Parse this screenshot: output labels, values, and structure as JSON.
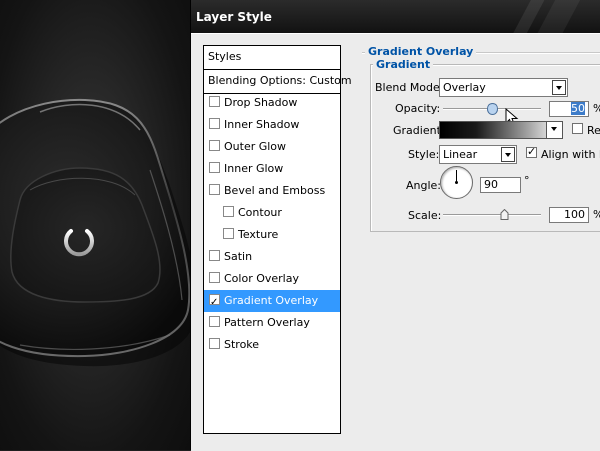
{
  "dialog": {
    "title": "Layer Style"
  },
  "styles_list": {
    "header": "Styles",
    "blending_options": "Blending Options: Custom",
    "items": [
      {
        "label": "Drop Shadow",
        "checked": false,
        "sub": false,
        "selected": false
      },
      {
        "label": "Inner Shadow",
        "checked": false,
        "sub": false,
        "selected": false
      },
      {
        "label": "Outer Glow",
        "checked": false,
        "sub": false,
        "selected": false
      },
      {
        "label": "Inner Glow",
        "checked": false,
        "sub": false,
        "selected": false
      },
      {
        "label": "Bevel and Emboss",
        "checked": false,
        "sub": false,
        "selected": false
      },
      {
        "label": "Contour",
        "checked": false,
        "sub": true,
        "selected": false
      },
      {
        "label": "Texture",
        "checked": false,
        "sub": true,
        "selected": false
      },
      {
        "label": "Satin",
        "checked": false,
        "sub": false,
        "selected": false
      },
      {
        "label": "Color Overlay",
        "checked": false,
        "sub": false,
        "selected": false
      },
      {
        "label": "Gradient Overlay",
        "checked": true,
        "sub": false,
        "selected": true
      },
      {
        "label": "Pattern Overlay",
        "checked": false,
        "sub": false,
        "selected": false
      },
      {
        "label": "Stroke",
        "checked": false,
        "sub": false,
        "selected": false
      }
    ]
  },
  "gradient_overlay": {
    "section_title": "Gradient Overlay",
    "group_title": "Gradient",
    "blend_mode_label": "Blend Mode:",
    "blend_mode_value": "Overlay",
    "opacity_label": "Opacity:",
    "opacity_value": "50",
    "opacity_unit": "%",
    "opacity_level": 0.5,
    "gradient_label": "Gradient:",
    "reverse_label": "Rev",
    "reverse_checked": false,
    "style_label": "Style:",
    "style_value": "Linear",
    "align_label": "Align with La",
    "align_checked": true,
    "angle_label": "Angle:",
    "angle_value": "90",
    "angle_unit": "°",
    "scale_label": "Scale:",
    "scale_value": "100",
    "scale_unit": "%"
  },
  "colors": {
    "accent_blue": "#0053a6",
    "selection": "#3399ff",
    "dialog_bg": "#ececec",
    "titlebar": "#1a1a1a"
  },
  "icons": [
    "power-icon",
    "mouse-cursor-icon",
    "dropdown-arrow-icon",
    "checkbox-icon",
    "slider-thumb-icon",
    "angle-dial-icon"
  ]
}
